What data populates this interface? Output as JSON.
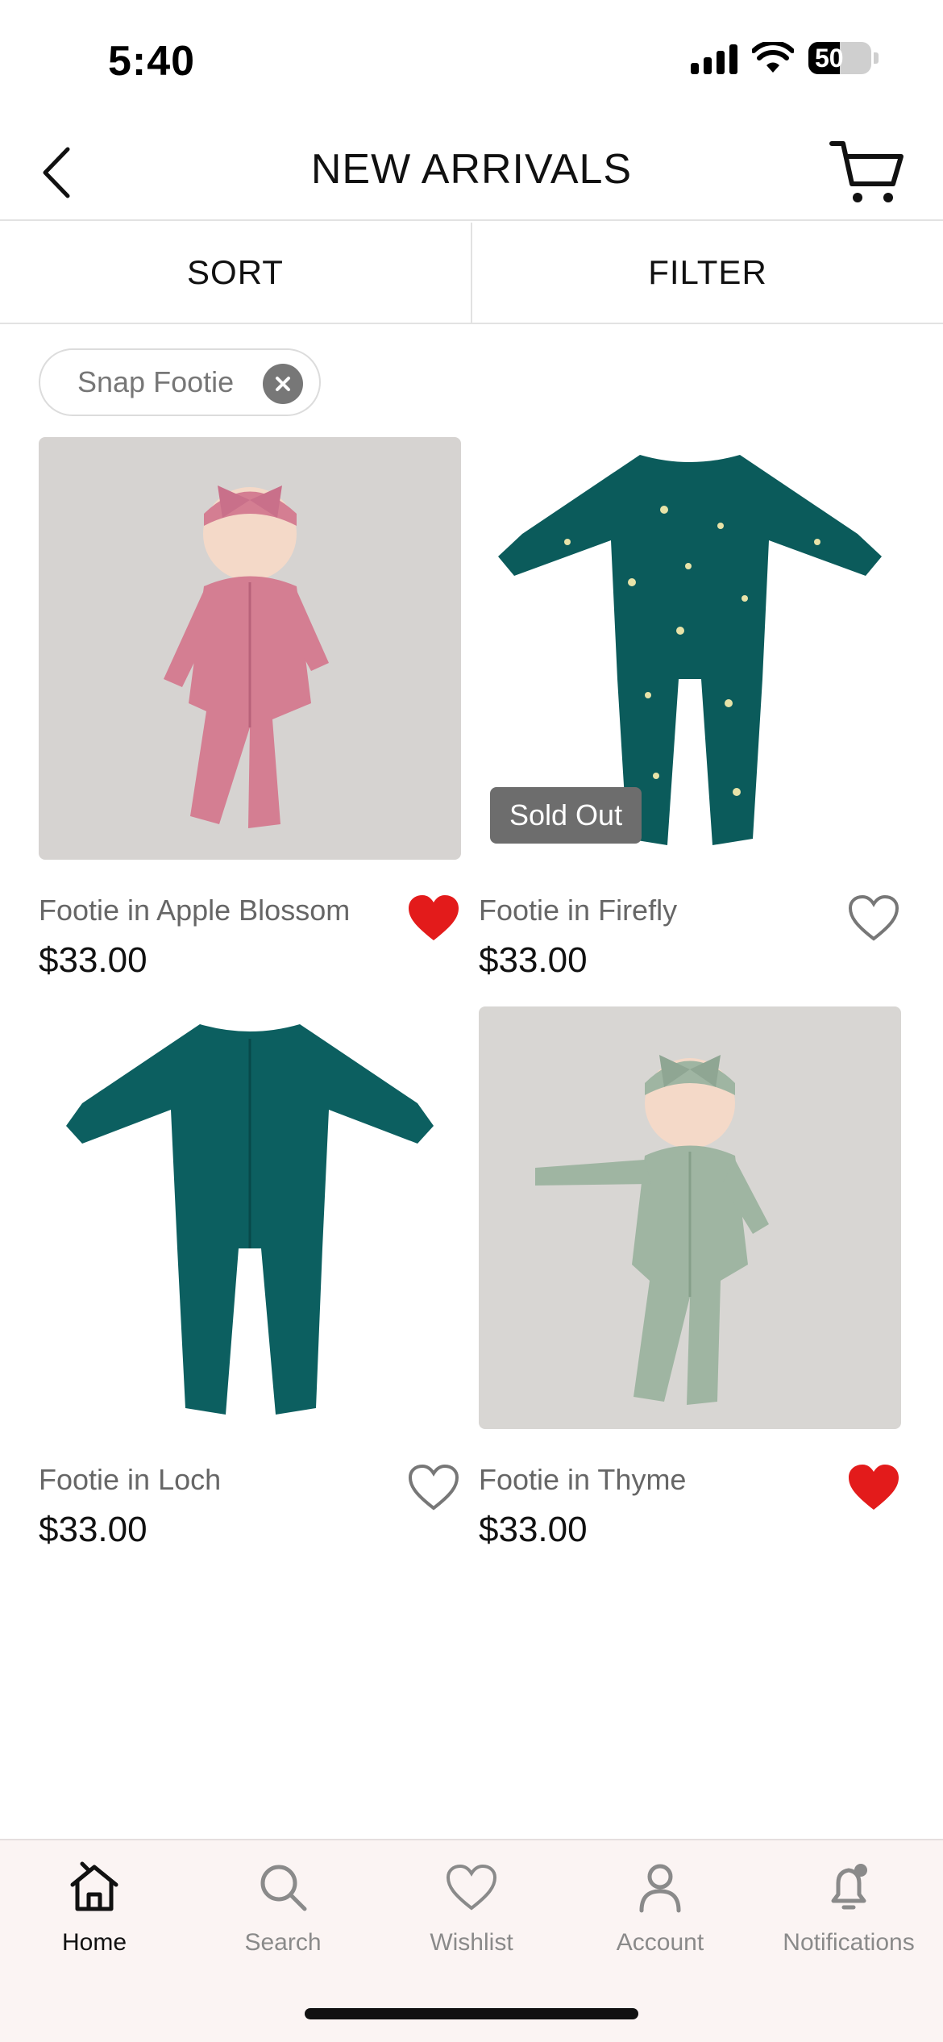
{
  "status_bar": {
    "time": "5:40",
    "battery": "50",
    "battery_level": 0.5
  },
  "header": {
    "title": "NEW ARRIVALS",
    "back_icon": "chevron-left-icon",
    "cart_icon": "cart-icon"
  },
  "toolbar": {
    "sort_label": "SORT",
    "filter_label": "FILTER"
  },
  "active_filter": {
    "label": "Snap Footie"
  },
  "products": [
    {
      "name": "Footie in Apple Blossom",
      "price": "$33.00",
      "wishlisted": true,
      "sold_out": false,
      "color": "#d47e92"
    },
    {
      "name": "Footie in Firefly",
      "price": "$33.00",
      "wishlisted": false,
      "sold_out": true,
      "sold_label": "Sold Out",
      "color": "#0b5b5b"
    },
    {
      "name": "Footie in Loch",
      "price": "$33.00",
      "wishlisted": false,
      "sold_out": false,
      "color": "#0c5f60"
    },
    {
      "name": "Footie in Thyme",
      "price": "$33.00",
      "wishlisted": true,
      "sold_out": false,
      "color": "#9fb5a2"
    }
  ],
  "colors": {
    "heart_active": "#e31b1b",
    "heart_inactive": "#777777",
    "nav_bg": "#fbf4f3"
  },
  "nav": [
    {
      "label": "Home",
      "icon": "home-icon",
      "active": true
    },
    {
      "label": "Search",
      "icon": "search-icon",
      "active": false
    },
    {
      "label": "Wishlist",
      "icon": "heart-icon",
      "active": false
    },
    {
      "label": "Account",
      "icon": "person-icon",
      "active": false
    },
    {
      "label": "Notifications",
      "icon": "bell-icon",
      "active": false
    }
  ]
}
